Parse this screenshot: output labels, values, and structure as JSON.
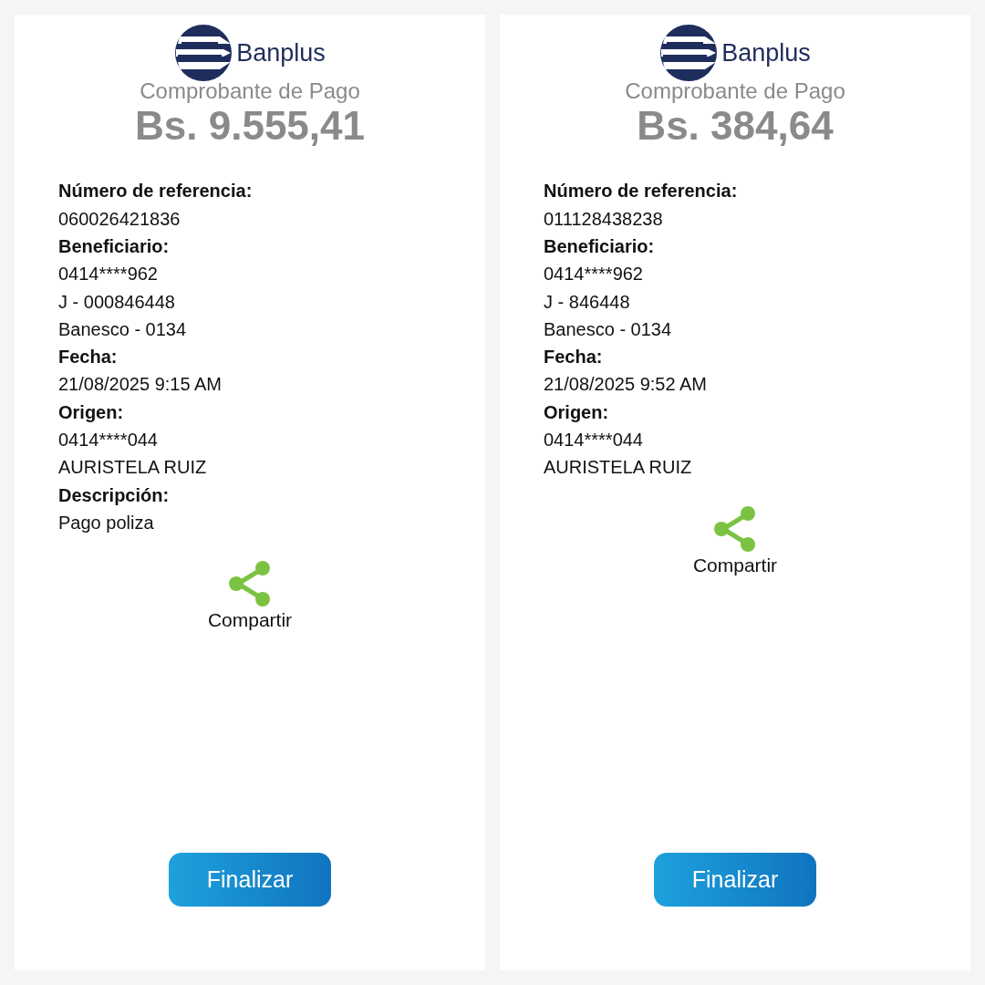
{
  "receipts": [
    {
      "brand": "Banplus",
      "title": "Comprobante de Pago",
      "amount": "Bs. 9.555,41",
      "fields": [
        {
          "label": "Número de referencia:",
          "values": [
            "060026421836"
          ]
        },
        {
          "label": "Beneficiario:",
          "values": [
            "0414****962",
            "J - 000846448",
            "Banesco - 0134"
          ]
        },
        {
          "label": "Fecha:",
          "values": [
            "21/08/2025 9:15 AM"
          ]
        },
        {
          "label": "Origen:",
          "values": [
            "0414****044",
            "AURISTELA RUIZ"
          ]
        },
        {
          "label": "Descripción:",
          "values": [
            "Pago poliza"
          ]
        }
      ],
      "share_label": "Compartir",
      "button": "Finalizar"
    },
    {
      "brand": "Banplus",
      "title": "Comprobante de Pago",
      "amount": "Bs. 384,64",
      "fields": [
        {
          "label": "Número de referencia:",
          "values": [
            "011128438238"
          ]
        },
        {
          "label": "Beneficiario:",
          "values": [
            "0414****962",
            "J - 846448",
            "Banesco - 0134"
          ]
        },
        {
          "label": "Fecha:",
          "values": [
            "21/08/2025 9:52 AM"
          ]
        },
        {
          "label": "Origen:",
          "values": [
            "0414****044",
            "AURISTELA RUIZ"
          ]
        }
      ],
      "share_label": "Compartir",
      "button": "Finalizar"
    }
  ]
}
